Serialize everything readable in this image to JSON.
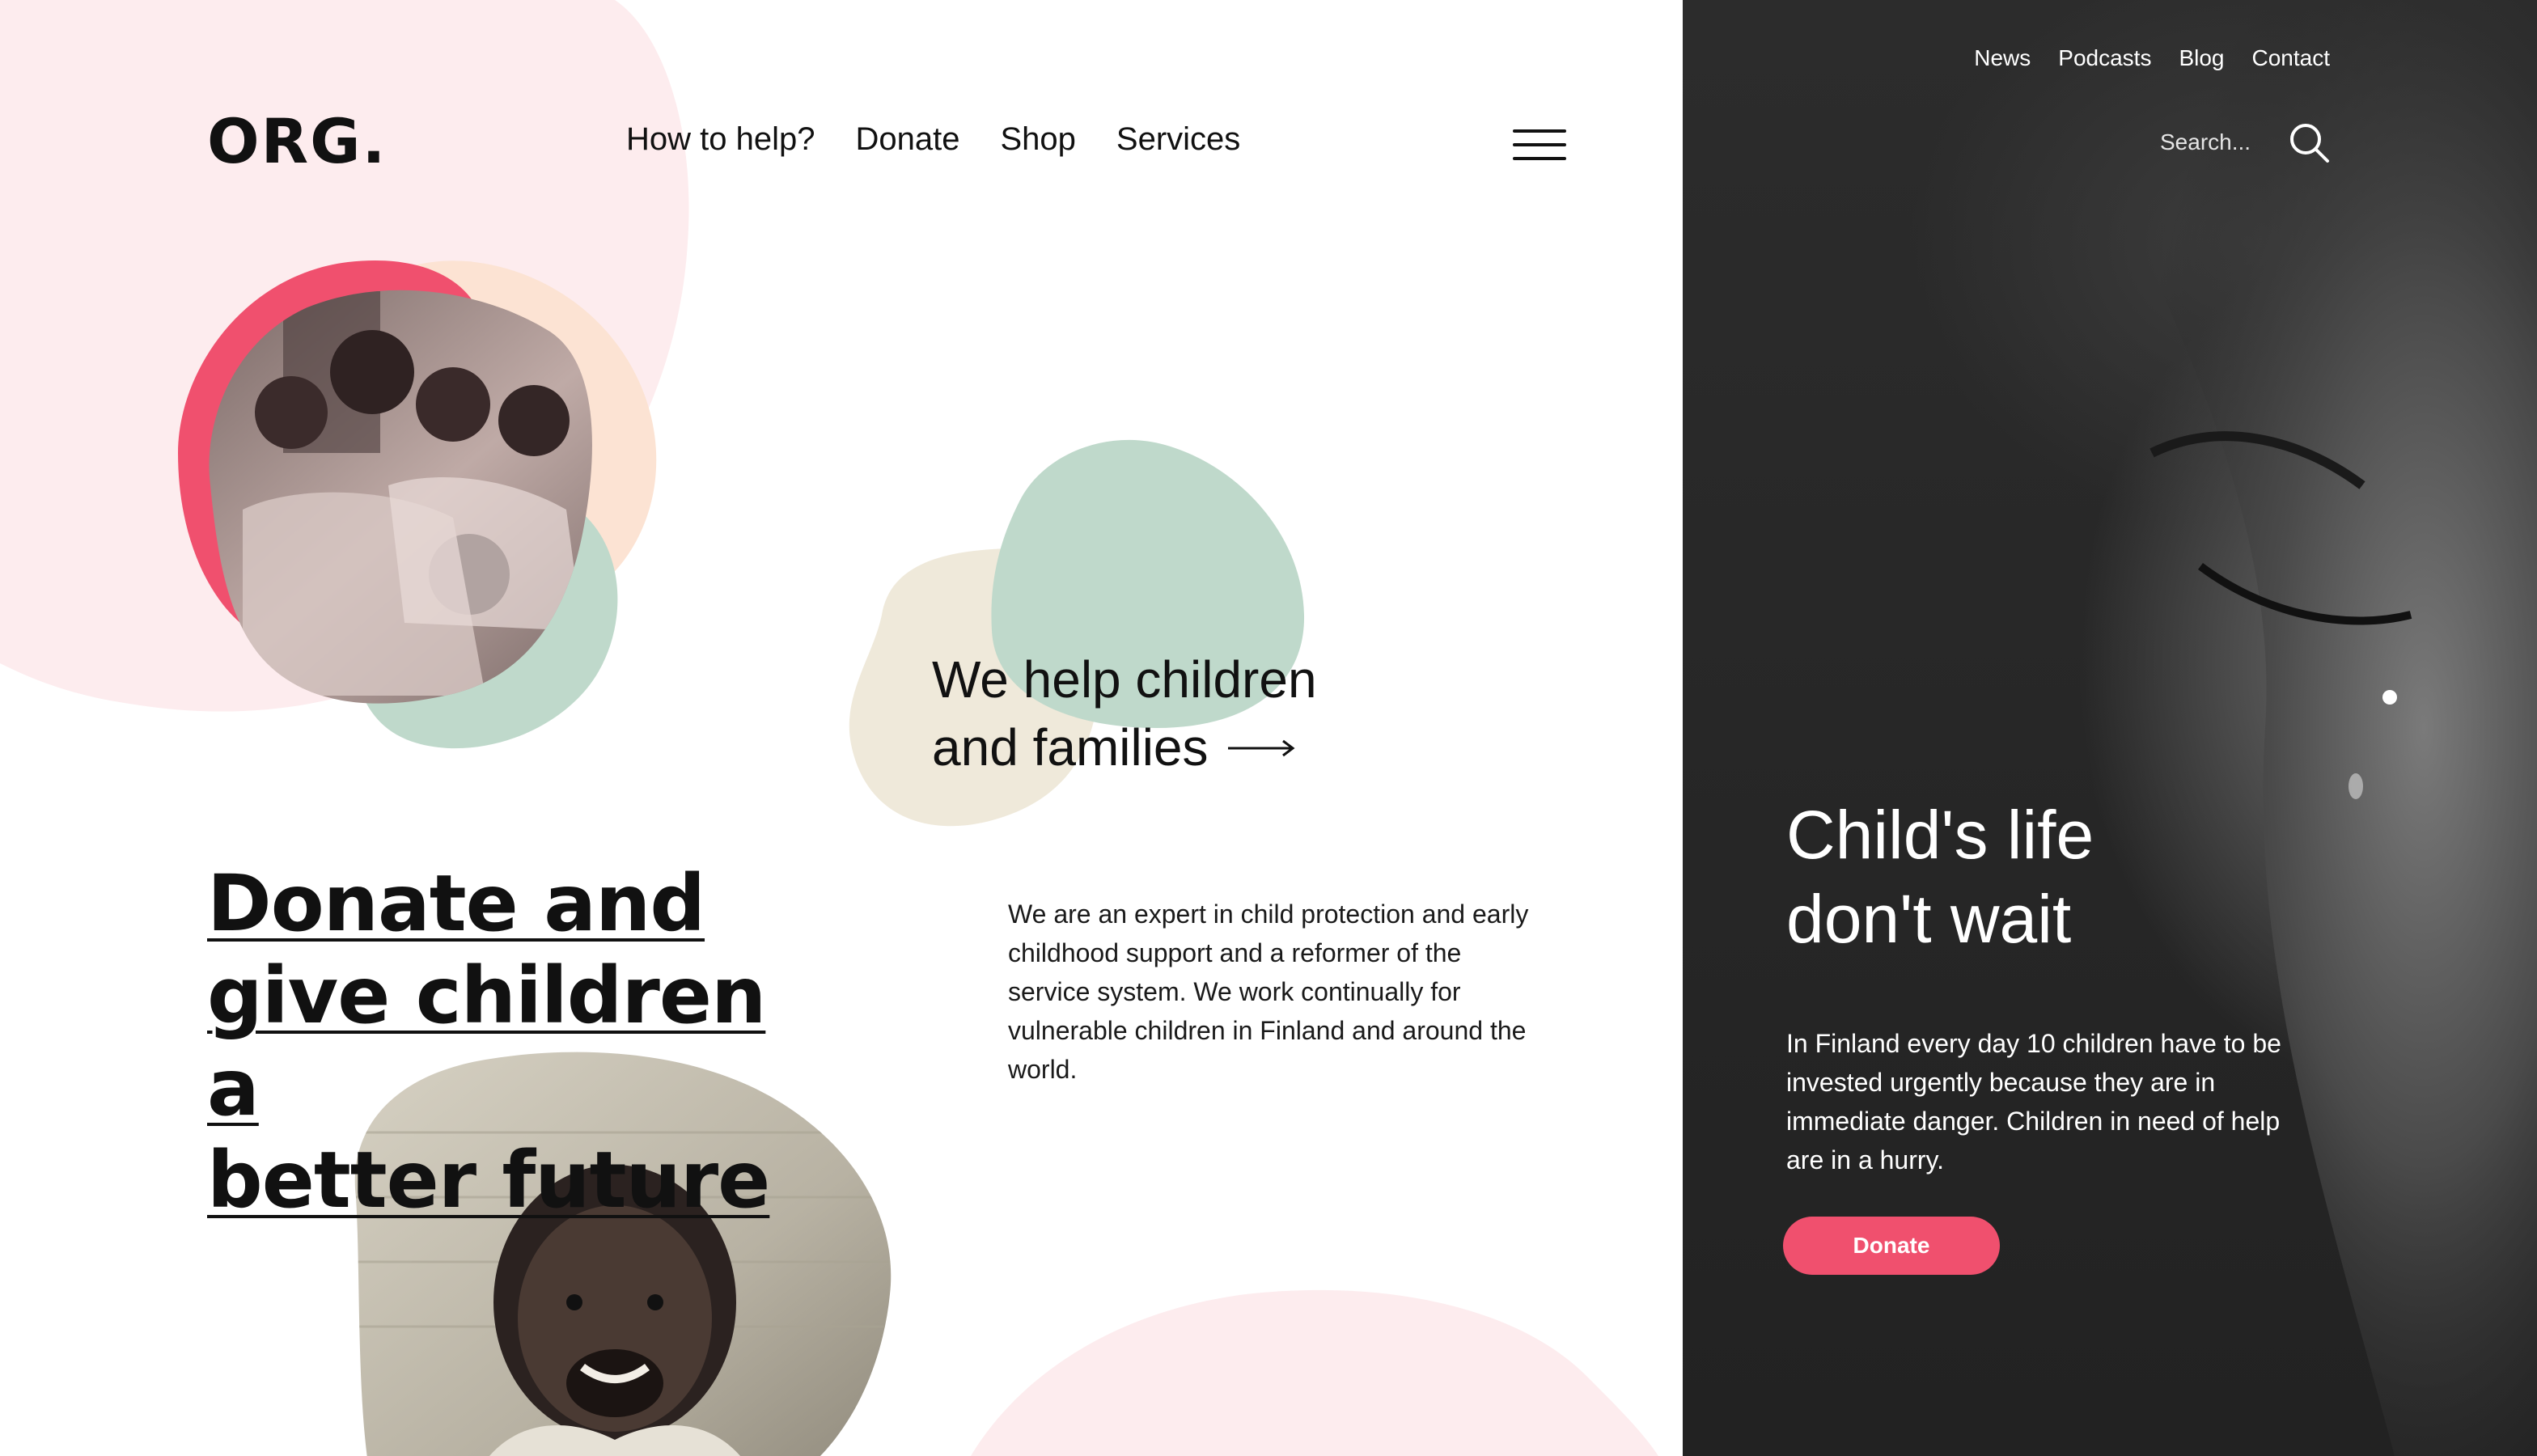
{
  "brand": {
    "logo": "ORG."
  },
  "main_nav": {
    "items": [
      {
        "label": "How to help?"
      },
      {
        "label": "Donate"
      },
      {
        "label": "Shop"
      },
      {
        "label": "Services"
      }
    ]
  },
  "utility_nav": {
    "items": [
      {
        "label": "News"
      },
      {
        "label": "Podcasts"
      },
      {
        "label": "Blog"
      },
      {
        "label": "Contact"
      }
    ]
  },
  "search": {
    "placeholder": "Search..."
  },
  "tagline": {
    "line1": "We help children",
    "line2": "and families"
  },
  "headline": {
    "line1": "Donate and",
    "line2": "give children a",
    "line3": "better future"
  },
  "about": {
    "text": "We are an expert in child protection and early childhood support and a reformer of the service system. We work continually for vulnerable children in Finland and around the world."
  },
  "hero": {
    "title_line1": "Child's life",
    "title_line2": "don't wait",
    "text": "In Finland every day 10 children have to be invested urgently because they are in immediate danger. Children in need of help are in a hurry.",
    "button_label": "Donate"
  },
  "colors": {
    "accent_pink": "#f0506e",
    "blob_light_pink": "#fdecee",
    "blob_peach": "#fce3d3",
    "blob_mint": "#bfd9cb",
    "blob_beige": "#efe9da",
    "dark_panel": "#2b2b2b"
  },
  "icons": {
    "menu": "hamburger-icon",
    "search": "magnifier-icon",
    "arrow": "arrow-right-icon"
  }
}
